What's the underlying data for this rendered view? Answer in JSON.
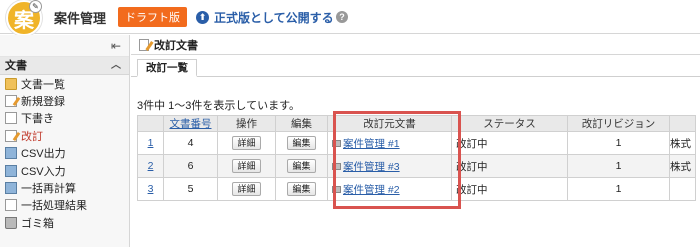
{
  "header": {
    "logo_glyph": "案",
    "app_title": "案件管理",
    "draft_badge": "ドラフト版",
    "publish_label": "正式版として公開する",
    "publish_icon": "upload-circle-icon",
    "help_icon": "help-icon",
    "accent_color": "#f26b1d",
    "link_color": "#2a5ea8"
  },
  "sidebar": {
    "collapse_icon": "collapse-left-icon",
    "section_title": "文書",
    "section_toggle_icon": "chevron-up-icon",
    "items": [
      {
        "label": "文書一覧",
        "icon": "folder-icon",
        "active": false
      },
      {
        "label": "新規登録",
        "icon": "edit-icon",
        "active": false
      },
      {
        "label": "下書き",
        "icon": "doc-icon",
        "active": false
      },
      {
        "label": "改訂",
        "icon": "edit-icon",
        "active": true
      },
      {
        "label": "CSV出力",
        "icon": "calc-icon",
        "active": false
      },
      {
        "label": "CSV入力",
        "icon": "calc-icon",
        "active": false
      },
      {
        "label": "一括再計算",
        "icon": "calc-icon",
        "active": false
      },
      {
        "label": "一括処理結果",
        "icon": "doc-icon",
        "active": false
      },
      {
        "label": "ゴミ箱",
        "icon": "trash-icon",
        "active": false
      }
    ]
  },
  "main": {
    "page_title": "改訂文書",
    "tab_label": "改訂一覧",
    "summary": "3件中 1～3件を表示しています。",
    "columns": [
      "",
      "文書番号",
      "操作",
      "編集",
      "改訂元文書",
      "ステータス",
      "改訂リビジョン",
      ""
    ],
    "rows": [
      {
        "no": "1",
        "doc_no": "4",
        "detail": "詳細",
        "edit": "編集",
        "source": "案件管理 #1",
        "status": "改訂中",
        "revision": "1",
        "extra": "株式"
      },
      {
        "no": "2",
        "doc_no": "6",
        "detail": "詳細",
        "edit": "編集",
        "source": "案件管理 #3",
        "status": "改訂中",
        "revision": "1",
        "extra": "株式"
      },
      {
        "no": "3",
        "doc_no": "5",
        "detail": "詳細",
        "edit": "編集",
        "source": "案件管理 #2",
        "status": "改訂中",
        "revision": "1",
        "extra": ""
      }
    ],
    "highlight_color": "#d9534f"
  }
}
